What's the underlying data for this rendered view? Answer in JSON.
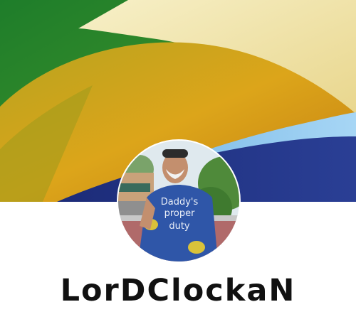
{
  "profile": {
    "username": "LorDClockaN",
    "shirt_text": [
      "Daddy's",
      "proper",
      "duty"
    ]
  },
  "cover": {
    "colors": {
      "green": "#2f8a2c",
      "cream": "#efe2a6",
      "yellow_orange": "#d9a418",
      "olive": "#a89a1c",
      "navy": "#1f2f7a",
      "light_blue": "#8cc7ef"
    }
  },
  "icons": {
    "cover": "abstract-paper-waves",
    "avatar": "profile-photo"
  }
}
